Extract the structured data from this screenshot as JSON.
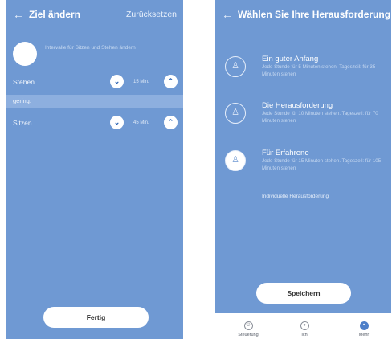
{
  "left": {
    "back_icon": "arrow-left-icon",
    "title": "Ziel ändern",
    "reset_label": "Zurücksetzen",
    "help_text": "Intervalle für Sitzen und Stehen ändern",
    "standing_label": "Stehen",
    "standing_value": "15 Min.",
    "section_label": "gering.",
    "sitting_label": "Sitzen",
    "sitting_value": "45 Min.",
    "done_label": "Fertig"
  },
  "right": {
    "back_icon": "arrow-left-icon",
    "title": "Wählen Sie Ihre Herausforderung",
    "options": [
      {
        "title": "Ein guter Anfang",
        "desc": "Jede Stunde für 5 Minuten stehen. Tageszeil: für 35 Minuten stehen",
        "selected": false
      },
      {
        "title": "Die Herausforderung",
        "desc": "Jede Stunde für 10 Minuten stehen. Tageszeil: für 70 Minuten stehen",
        "selected": false
      },
      {
        "title": "Für Erfahrene",
        "desc": "Jede Stunde für 15 Minuten stehen. Tageszeil: für 105 Minuten stehen",
        "selected": true
      }
    ],
    "custom_label": "Individuelle Herausforderung",
    "save_label": "Speichern",
    "nav": [
      {
        "label": "Steuerung",
        "icon": "power-icon",
        "active": false
      },
      {
        "label": "Ich",
        "icon": "person-icon",
        "active": false
      },
      {
        "label": "Mehr",
        "icon": "more-icon",
        "active": true
      }
    ]
  },
  "colors": {
    "background": "#6f99d3",
    "band": "#8dafdf",
    "accent": "#4d7fc9"
  }
}
